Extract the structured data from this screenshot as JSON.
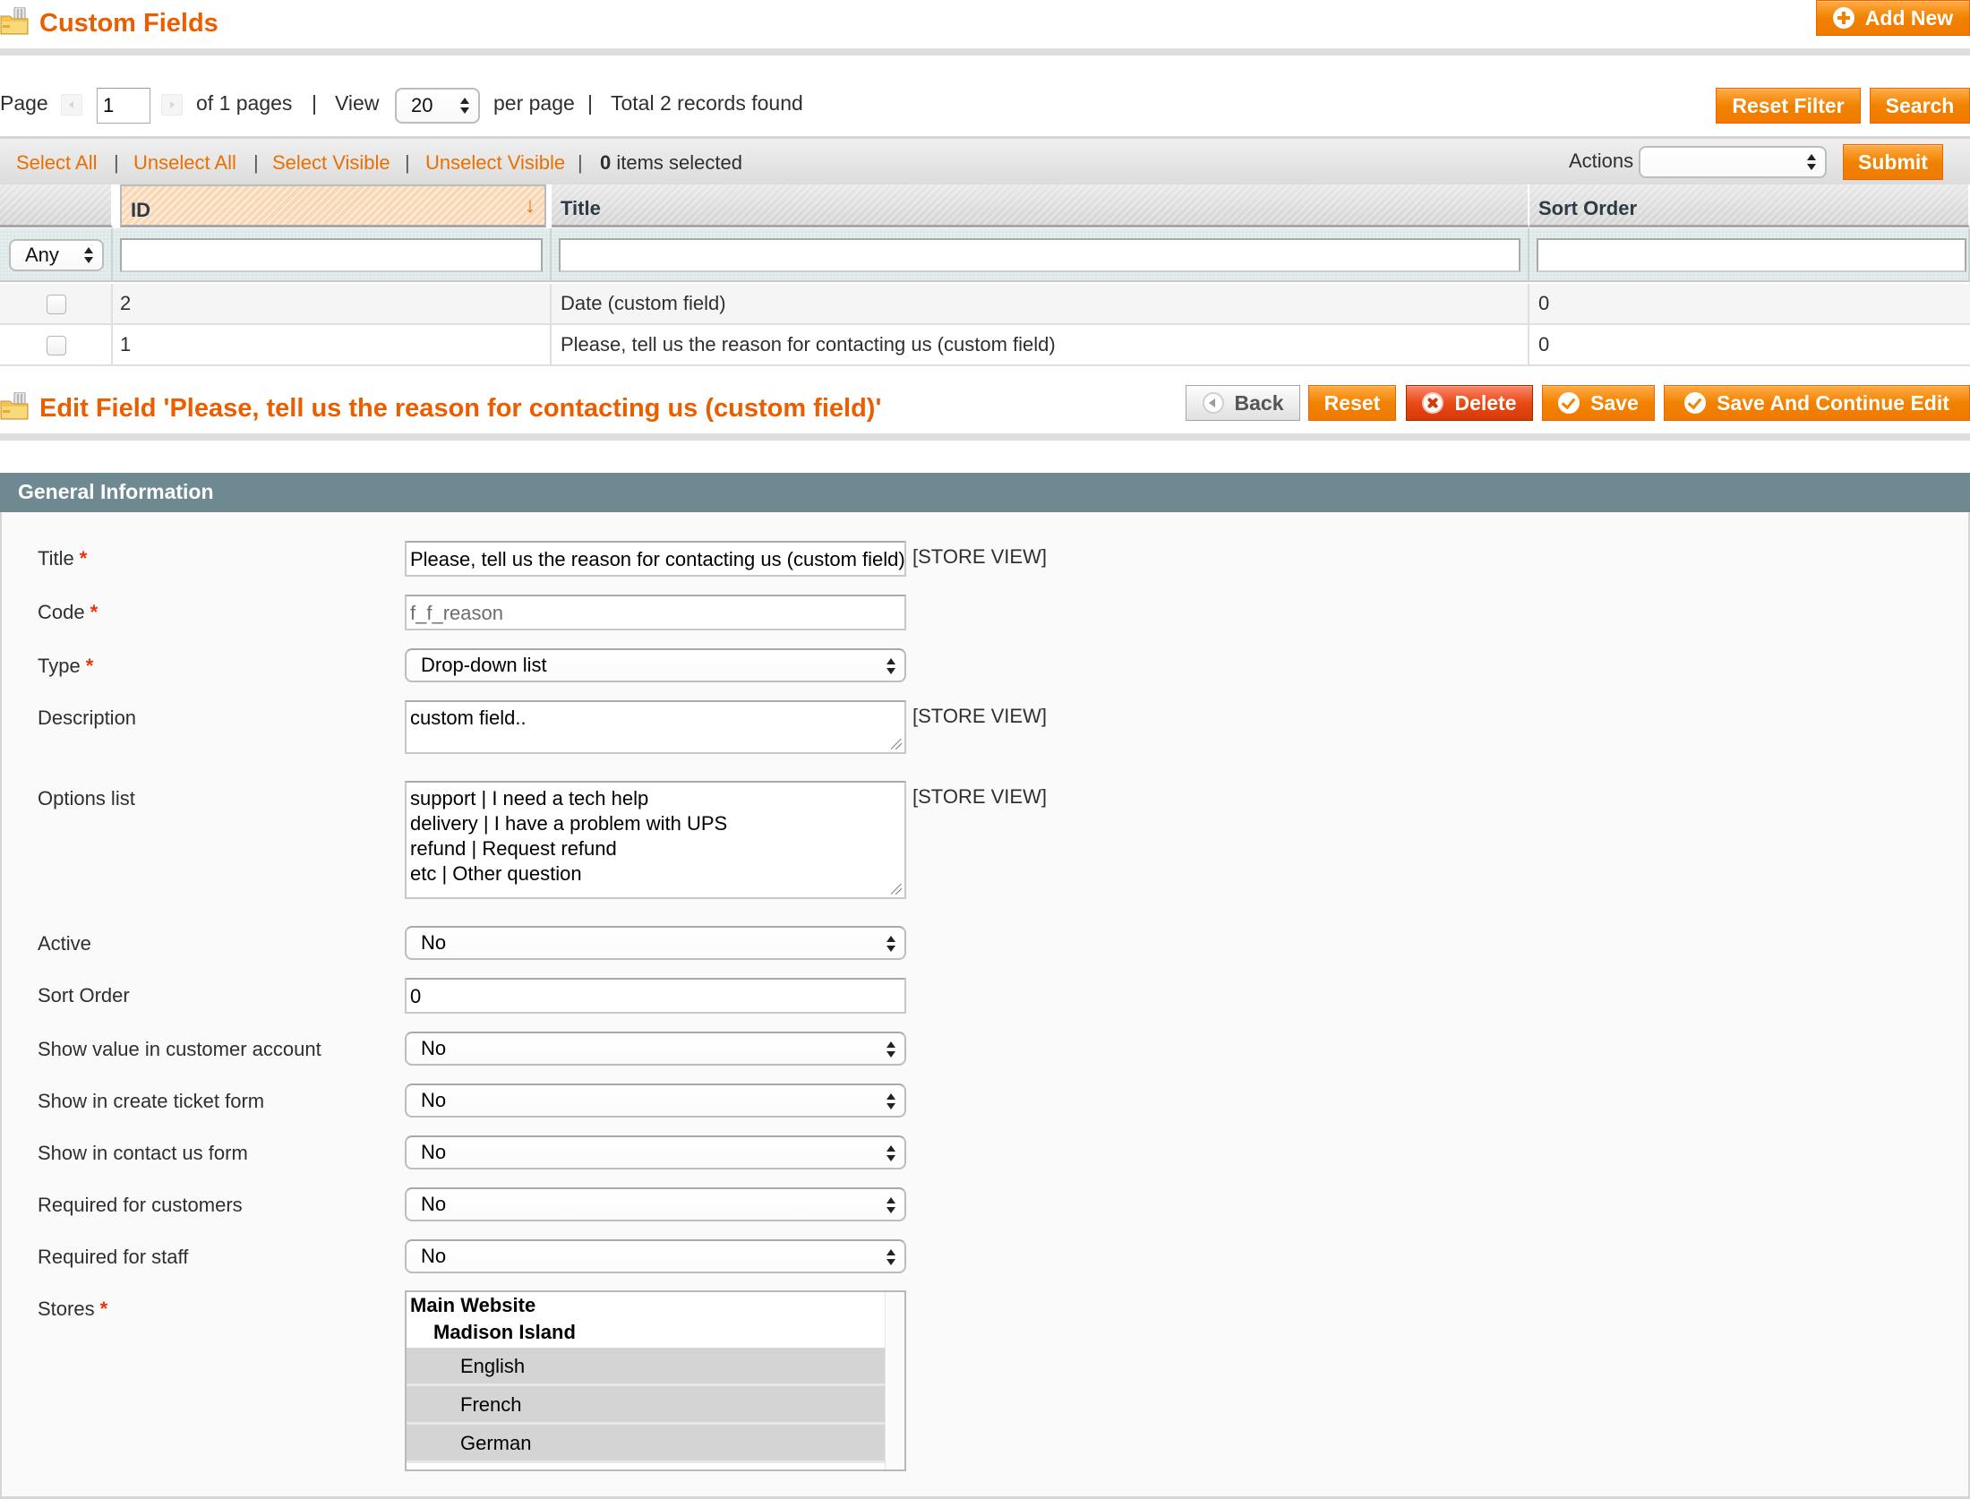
{
  "list_header": {
    "title": "Custom Fields",
    "add_new_label": "Add New"
  },
  "pager": {
    "page_label": "Page",
    "current_page": "1",
    "of_pages": "of 1 pages",
    "separator": "|",
    "view_label": "View",
    "per_page_value": "20",
    "per_page_label": "per page",
    "total_text": "Total 2 records found",
    "reset_filter_label": "Reset Filter",
    "search_label": "Search"
  },
  "massaction": {
    "select_all": "Select All",
    "unselect_all": "Unselect All",
    "select_visible": "Select Visible",
    "unselect_visible": "Unselect Visible",
    "separator": "|",
    "selected_count": "0",
    "selected_suffix": "items selected",
    "actions_label": "Actions",
    "actions_value": "",
    "submit_label": "Submit"
  },
  "grid": {
    "columns": [
      {
        "label": "ID",
        "sorted": "desc"
      },
      {
        "label": "Title"
      },
      {
        "label": "Sort Order"
      }
    ],
    "filter": {
      "checkbox_filter_value": "Any",
      "id": "",
      "title": "",
      "sort_order": ""
    },
    "rows": [
      {
        "id": "2",
        "title": "Date (custom field)",
        "sort_order": "0",
        "checked": false
      },
      {
        "id": "1",
        "title": "Please, tell us the reason for contacting us (custom field)",
        "sort_order": "0",
        "checked": false
      }
    ]
  },
  "edit_header": {
    "title": "Edit Field 'Please, tell us the reason for contacting us (custom field)'",
    "back_label": "Back",
    "reset_label": "Reset",
    "delete_label": "Delete",
    "save_label": "Save",
    "save_continue_label": "Save And Continue Edit"
  },
  "section": {
    "title": "General Information"
  },
  "form": {
    "store_view_label": "[STORE VIEW]",
    "title": {
      "label": "Title",
      "value": "Please, tell us the reason for contacting us  (custom field)"
    },
    "code": {
      "label": "Code",
      "value": "f_f_reason"
    },
    "type": {
      "label": "Type",
      "value": "Drop-down list"
    },
    "description": {
      "label": "Description",
      "value": "custom field.."
    },
    "options_list": {
      "label": "Options list",
      "lines": [
        "support | I need a tech help",
        "delivery | I have a problem with UPS",
        "refund | Request refund",
        "etc | Other question"
      ]
    },
    "active": {
      "label": "Active",
      "value": "No"
    },
    "sort_order": {
      "label": "Sort Order",
      "value": "0"
    },
    "show_in_customer_account": {
      "label": "Show value in customer account",
      "value": "No"
    },
    "show_in_create_ticket": {
      "label": "Show in create ticket form",
      "value": "No"
    },
    "show_in_contact_us": {
      "label": "Show in contact us form",
      "value": "No"
    },
    "required_for_customers": {
      "label": "Required for customers",
      "value": "No"
    },
    "required_for_staff": {
      "label": "Required for staff",
      "value": "No"
    },
    "stores": {
      "label": "Stores",
      "options": [
        {
          "label": "Main Website",
          "type": "website",
          "selected": false
        },
        {
          "label": "Madison Island",
          "type": "group",
          "selected": false
        },
        {
          "label": "English",
          "type": "store",
          "selected": true
        },
        {
          "label": "French",
          "type": "store",
          "selected": true
        },
        {
          "label": "German",
          "type": "store",
          "selected": true
        }
      ]
    },
    "required_marker": "*"
  },
  "colors": {
    "accent_orange": "#eb5e00",
    "link_orange": "#eb6f00",
    "section_bar": "#6f8992",
    "required_red": "#eb340a"
  }
}
